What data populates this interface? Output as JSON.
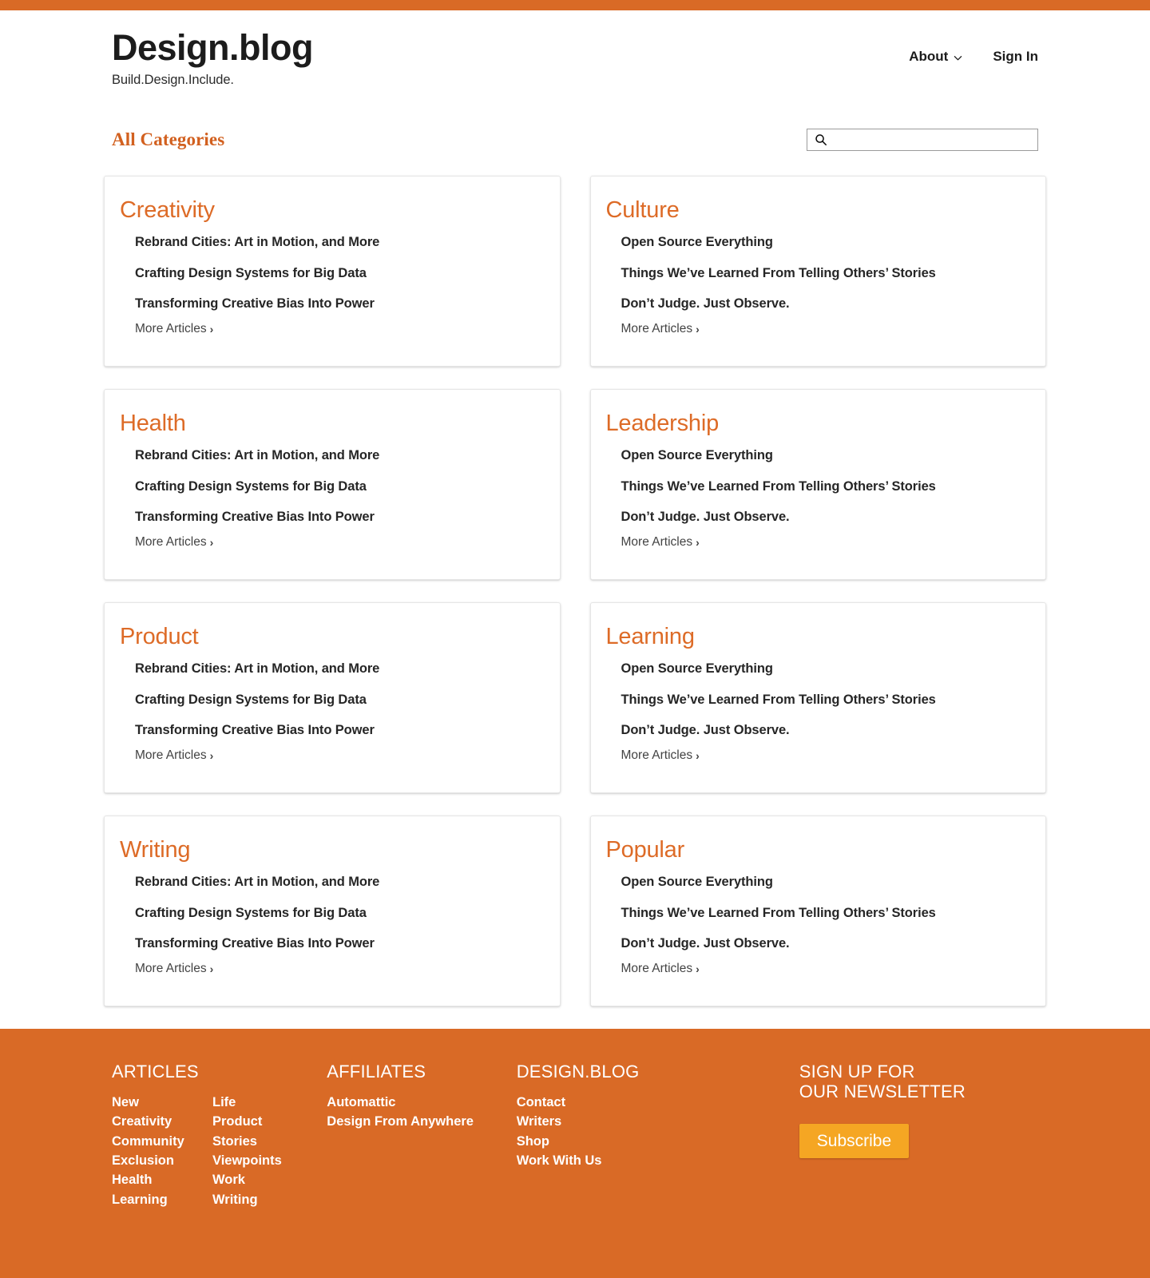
{
  "theme": {
    "accent_orange": "#d96a26",
    "title_orange": "#dd6b27",
    "heading_orange": "#d2601f",
    "subscribe_yellow": "#f5a623",
    "text_dark": "#262626",
    "muted_gray": "#434343"
  },
  "header": {
    "brand_title": "Design.blog",
    "brand_tagline": "Build.Design.Include.",
    "nav": [
      {
        "label": "About",
        "has_chevron": true,
        "icon": "chevron-down-icon"
      },
      {
        "label": "Sign In",
        "has_chevron": false
      }
    ]
  },
  "categories_bar": {
    "heading": "All Categories",
    "search": {
      "icon": "search-icon",
      "value": "",
      "placeholder": ""
    }
  },
  "cards": [
    {
      "title": "Creativity",
      "articles": [
        "Rebrand Cities: Art in Motion, and More",
        "Crafting Design Systems for Big Data",
        "Transforming Creative Bias Into Power"
      ],
      "more_label": "More Articles",
      "more_chevron": "›"
    },
    {
      "title": "Culture",
      "articles": [
        "Open Source Everything",
        "Things We’ve Learned From Telling Others’ Stories",
        "Don’t Judge. Just Observe."
      ],
      "more_label": "More Articles",
      "more_chevron": "›"
    },
    {
      "title": "Health",
      "articles": [
        "Rebrand Cities: Art in Motion, and More",
        "Crafting Design Systems for Big Data",
        "Transforming Creative Bias Into Power"
      ],
      "more_label": "More Articles",
      "more_chevron": "›"
    },
    {
      "title": "Leadership",
      "articles": [
        "Open Source Everything",
        "Things We’ve Learned From Telling Others’ Stories",
        "Don’t Judge. Just Observe."
      ],
      "more_label": "More Articles",
      "more_chevron": "›"
    },
    {
      "title": "Product",
      "articles": [
        "Rebrand Cities: Art in Motion, and More",
        "Crafting Design Systems for Big Data",
        "Transforming Creative Bias Into Power"
      ],
      "more_label": "More Articles",
      "more_chevron": "›"
    },
    {
      "title": "Learning",
      "articles": [
        "Open Source Everything",
        "Things We’ve Learned From Telling Others’ Stories",
        "Don’t Judge. Just Observe."
      ],
      "more_label": "More Articles",
      "more_chevron": "›"
    },
    {
      "title": "Writing",
      "articles": [
        "Rebrand Cities: Art in Motion, and More",
        "Crafting Design Systems for Big Data",
        "Transforming Creative Bias Into Power"
      ],
      "more_label": "More Articles",
      "more_chevron": "›"
    },
    {
      "title": "Popular",
      "articles": [
        "Open Source Everything",
        "Things We’ve Learned From Telling Others’ Stories",
        "Don’t Judge. Just Observe."
      ],
      "more_label": "More Articles",
      "more_chevron": "›"
    }
  ],
  "footer": {
    "articles": {
      "heading": "ARTICLES",
      "column_a": [
        "New",
        "Creativity",
        "Community",
        "Exclusion",
        "Health",
        "Learning"
      ],
      "column_b": [
        "Life",
        "Product",
        "Stories",
        "Viewpoints",
        "Work",
        "Writing"
      ]
    },
    "affiliates": {
      "heading": "AFFILIATES",
      "links": [
        "Automattic",
        "Design From Anywhere"
      ]
    },
    "designblog": {
      "heading": "DESIGN.BLOG",
      "links": [
        "Contact",
        "Writers",
        "Shop",
        "Work With Us"
      ]
    },
    "newsletter": {
      "heading_line1": "SIGN UP FOR",
      "heading_line2": "OUR NEWSLETTER",
      "subscribe_label": "Subscribe"
    }
  }
}
